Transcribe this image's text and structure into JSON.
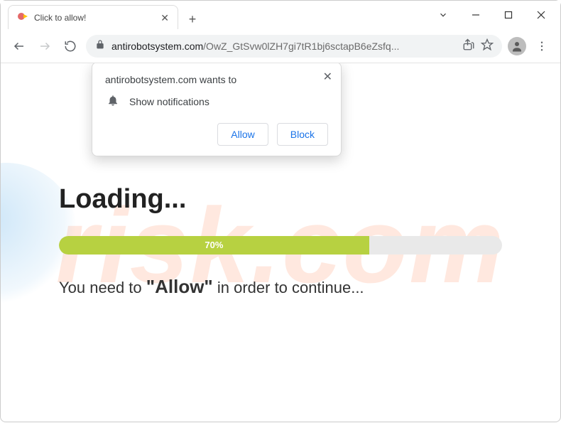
{
  "window": {
    "tab_title": "Click to allow!"
  },
  "toolbar": {
    "url_host": "antirobotsystem.com",
    "url_path": "/OwZ_GtSvw0lZH7gi7tR1bj6sctapB6eZsfq..."
  },
  "perm": {
    "origin_text": "antirobotsystem.com wants to",
    "permission_label": "Show notifications",
    "allow_label": "Allow",
    "block_label": "Block"
  },
  "page": {
    "heading": "Loading...",
    "progress_pct": 70,
    "progress_label": "70%",
    "instruction_prefix": "You need to ",
    "instruction_emph": "\"Allow\"",
    "instruction_suffix": " in order to continue...",
    "watermark_text": "risk.com"
  }
}
